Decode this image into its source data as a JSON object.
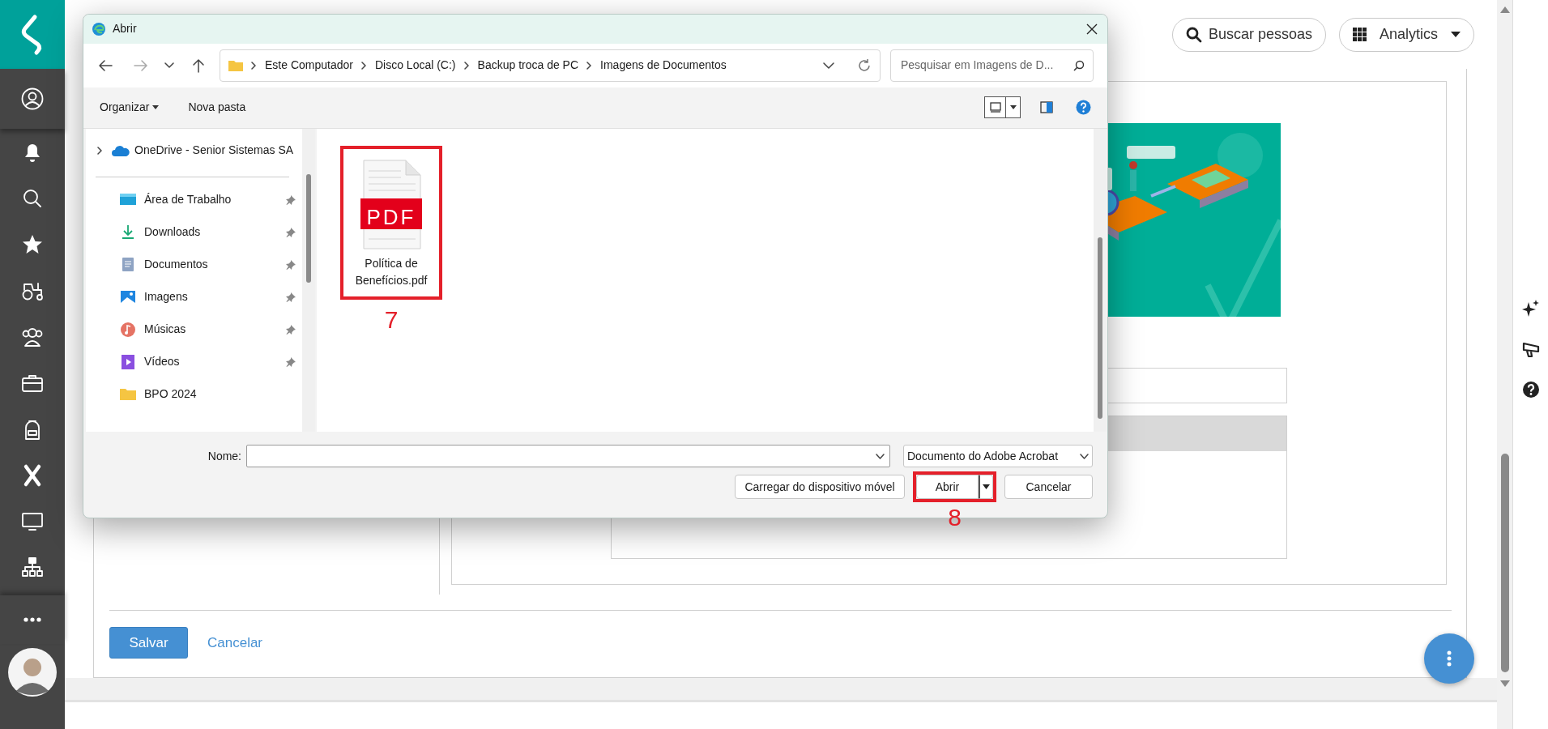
{
  "header": {
    "search_button": "Buscar pessoas",
    "apps_menu": "Analytics"
  },
  "form": {
    "save_button": "Salvar",
    "cancel_link": "Cancelar"
  },
  "dialog": {
    "title": "Abrir",
    "breadcrumb": [
      "Este Computador",
      "Disco Local (C:)",
      "Backup troca de PC",
      "Imagens de Documentos"
    ],
    "search": {
      "placeholder": "Pesquisar em Imagens de D..."
    },
    "toolbar": {
      "organize_menu": "Organizar",
      "new_folder": "Nova pasta"
    },
    "nav_root": {
      "label": "OneDrive - Senior Sistemas SA",
      "expanded": false
    },
    "nav_items": [
      {
        "label": "Área de Trabalho",
        "kind": "desktop",
        "pinned": true
      },
      {
        "label": "Downloads",
        "kind": "download",
        "pinned": true
      },
      {
        "label": "Documentos",
        "kind": "documents",
        "pinned": true
      },
      {
        "label": "Imagens",
        "kind": "pictures",
        "pinned": true
      },
      {
        "label": "Músicas",
        "kind": "music",
        "pinned": true
      },
      {
        "label": "Vídeos",
        "kind": "videos",
        "pinned": true
      },
      {
        "label": "BPO 2024",
        "kind": "folder",
        "pinned": false
      }
    ],
    "files": [
      {
        "name": "Política de Benefícios.pdf",
        "type_label": "PDF",
        "highlighted": true,
        "annotation": "7"
      }
    ],
    "name_label": "Nome:",
    "file_type": "Documento do Adobe Acrobat",
    "buttons": [
      {
        "label": "Carregar do dispositivo móvel",
        "kind": "plain",
        "highlighted": false
      },
      {
        "label": "Abrir",
        "kind": "split",
        "highlighted": true,
        "annotation": "8"
      },
      {
        "label": "Cancelar",
        "kind": "plain",
        "highlighted": false
      }
    ]
  }
}
